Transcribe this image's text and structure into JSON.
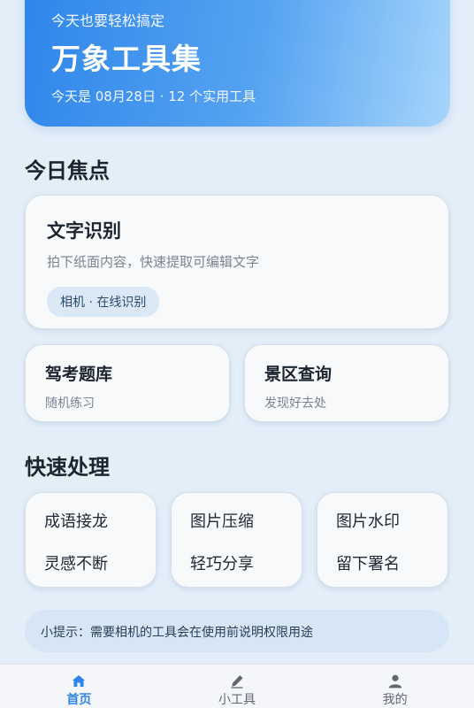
{
  "hero": {
    "subtitle": "今天也要轻松搞定",
    "title": "万象工具集",
    "date_line": "今天是 08月28日 · 12 个实用工具"
  },
  "focus": {
    "heading": "今日焦点",
    "feature": {
      "title": "文字识别",
      "desc": "拍下纸面内容，快速提取可编辑文字",
      "chip": "相机 · 在线识别"
    },
    "cards": [
      {
        "title": "驾考题库",
        "desc": "随机练习"
      },
      {
        "title": "景区查询",
        "desc": "发现好去处"
      }
    ]
  },
  "quick": {
    "heading": "快速处理",
    "items": [
      {
        "line1": "成语接龙",
        "line2": "灵感不断"
      },
      {
        "line1": "图片压缩",
        "line2": "轻巧分享"
      },
      {
        "line1": "图片水印",
        "line2": "留下署名"
      }
    ]
  },
  "tip": "小提示：需要相机的工具会在使用前说明权限用途",
  "tabs": [
    {
      "label": "首页",
      "icon": "home-icon",
      "active": true
    },
    {
      "label": "小工具",
      "icon": "edit-icon",
      "active": false
    },
    {
      "label": "我的",
      "icon": "user-icon",
      "active": false
    }
  ],
  "colors": {
    "accent": "#2f86ea",
    "background": "#e3eef9"
  }
}
